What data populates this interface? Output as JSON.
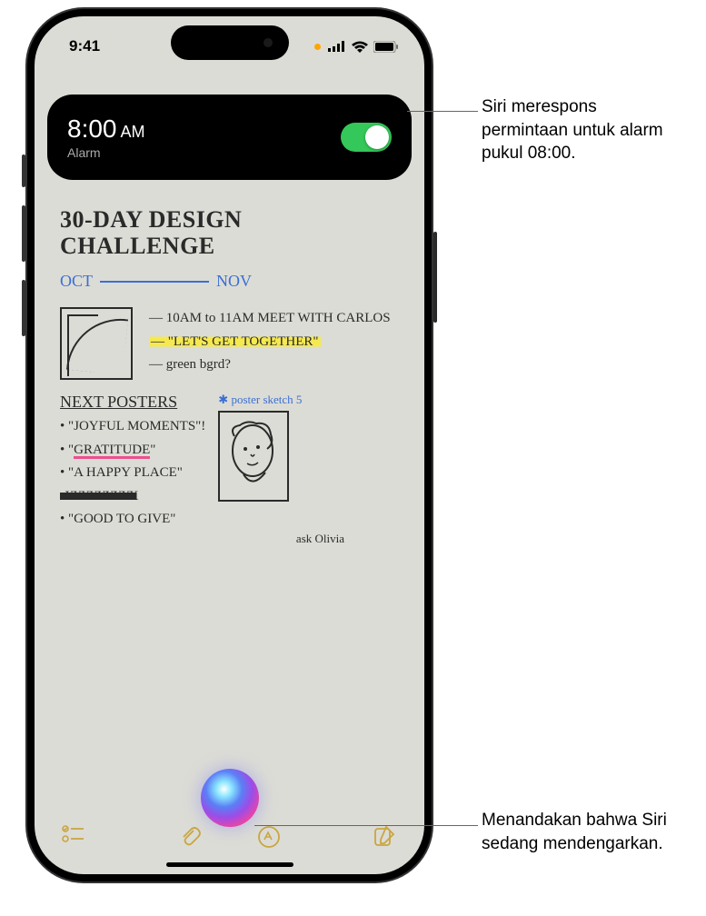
{
  "status_bar": {
    "time": "9:41"
  },
  "alarm_card": {
    "time": "8:00",
    "ampm": "AM",
    "label": "Alarm"
  },
  "note": {
    "title_line1": "30-DAY DESIGN",
    "title_line2": "CHALLENGE",
    "timeline_start": "OCT",
    "timeline_end": "NOV",
    "bullets": {
      "b1": "— 10AM to 11AM MEET WITH CARLOS",
      "b2": "— \"LET'S GET TOGETHER\"",
      "b3": "— green bgrd?"
    },
    "next_posters": {
      "title": "NEXT POSTERS",
      "p1": "• \"JOYFUL MOMENTS\"!",
      "p2": "• \"GRATITUDE\"",
      "p3": "• \"A HAPPY PLACE\"",
      "p4_scribble": "• XXXXXXXXX",
      "p5": "• \"GOOD TO GIVE\"",
      "ask": "ask Olivia",
      "sketch_label": "✱ poster sketch 5"
    }
  },
  "callouts": {
    "c1": "Siri merespons permintaan untuk alarm pukul 08:00.",
    "c2": "Menandakan bahwa Siri sedang mendengarkan."
  }
}
